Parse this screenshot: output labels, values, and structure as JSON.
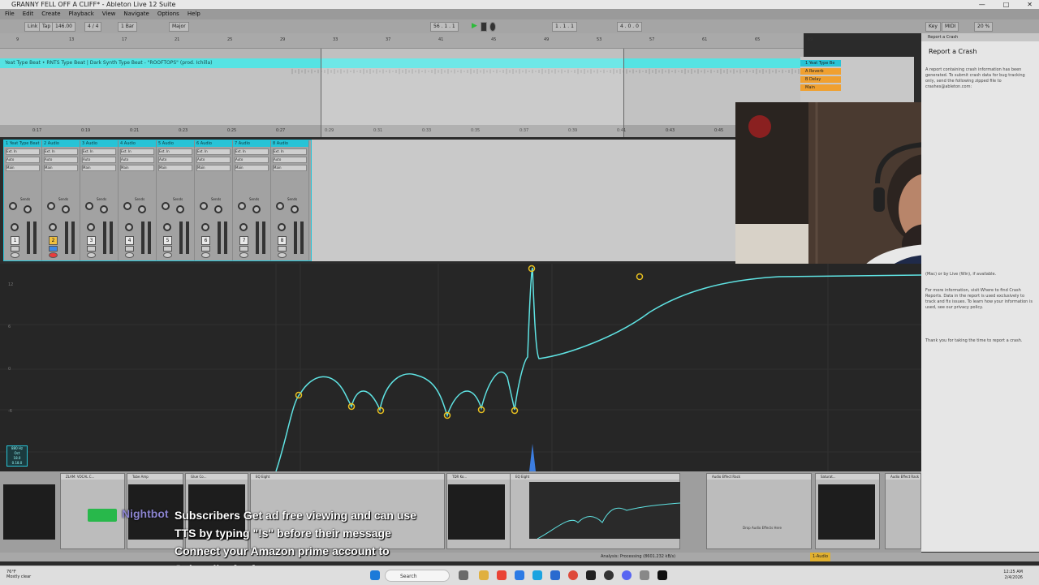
{
  "window": {
    "title": "GRANNY FELL OFF A CLIFF* - Ableton Live 12 Suite",
    "controls": [
      "—",
      "□",
      "✕"
    ]
  },
  "menu": [
    "File",
    "Edit",
    "Create",
    "Playback",
    "View",
    "Navigate",
    "Options",
    "Help"
  ],
  "controlbar": {
    "link": "Link",
    "tap": "Tap",
    "tempo": "146.00",
    "signature": "4 / 4",
    "bar": "1 Bar",
    "key": "Major",
    "position": "56 . 1 . 1",
    "loop_start": "1 . 1 . 1",
    "loop_len": "4 . 0 . 0",
    "zoom": "20 %",
    "key_btn": "Key",
    "midi": "MIDI",
    "cpu": "20 %"
  },
  "arrangement": {
    "clip_label": "Yeat Type Beat • RNTS Type Beat | Dark Synth Type Beat - \"ROOFTOPS\" (prod. Ichilla)",
    "ruler": [
      "9",
      "13",
      "17",
      "21",
      "25",
      "29",
      "33",
      "37",
      "41",
      "45",
      "49",
      "53",
      "57",
      "61",
      "65",
      "69"
    ],
    "timeline": [
      "0:17",
      "0:19",
      "0:21",
      "0:23",
      "0:25",
      "0:27",
      "0:29",
      "0:31",
      "0:33",
      "0:35",
      "0:37",
      "0:39",
      "0:41",
      "0:43",
      "0:45"
    ]
  },
  "track_heads": [
    {
      "name": "1 Yeat Type Be",
      "color": "#27c3d6"
    },
    {
      "name": "A Reverb",
      "color": "#f0a030"
    },
    {
      "name": "B Delay",
      "color": "#f0a030"
    },
    {
      "name": "Main",
      "color": "#f0a030"
    }
  ],
  "mixer": {
    "strips": [
      {
        "name": "1 Yeat Type Beat",
        "num": "1",
        "audio_from": "Ext. In",
        "monitor": "Auto",
        "audio_to": "Main"
      },
      {
        "name": "2 Audio",
        "num": "2",
        "audio_from": "Ext. In",
        "monitor": "Auto",
        "audio_to": "Main"
      },
      {
        "name": "3 Audio",
        "num": "3",
        "audio_from": "Ext. In",
        "monitor": "Auto",
        "audio_to": "Main"
      },
      {
        "name": "4 Audio",
        "num": "4",
        "audio_from": "Ext. In",
        "monitor": "Auto",
        "audio_to": "Main"
      },
      {
        "name": "5 Audio",
        "num": "5",
        "audio_from": "Ext. In",
        "monitor": "Auto",
        "audio_to": "Main"
      },
      {
        "name": "6 Audio",
        "num": "6",
        "audio_from": "Ext. In",
        "monitor": "Auto",
        "audio_to": "Main"
      },
      {
        "name": "7 Audio",
        "num": "7",
        "audio_from": "Ext. In",
        "monitor": "Auto",
        "audio_to": "Main"
      },
      {
        "name": "8 Audio",
        "num": "8",
        "audio_from": "Ext. In",
        "monitor": "Auto",
        "audio_to": "Main"
      }
    ],
    "sends_label": "Sends"
  },
  "eq": {
    "curve_color": "#5fe3e3",
    "node_color": "#e8c020",
    "y_labels": [
      "12",
      "6",
      "0",
      "-6"
    ],
    "loop_box": [
      "880 Hz",
      "Oct",
      "18.0",
      "0.18.0"
    ]
  },
  "crash": {
    "panel_title": "Report a Crash",
    "title": "Report a Crash",
    "text1": "A report containing crash information has been generated. To submit crash data for bug tracking only, send the following zipped file to crashes@ableton.com:",
    "text2": "(Mac) or by Live (Win), if available.",
    "text3": "For more information, visit Where to find Crash Reports. Data in the report is used exclusively to track and fix issues. To learn how your information is used, see our privacy policy.",
    "text4": "Thank you for taking the time to report a crash."
  },
  "devices": [
    {
      "name": "ZLAM: VOCAL C..."
    },
    {
      "name": "Tube Amp"
    },
    {
      "name": "Glue Co..."
    },
    {
      "name": "EQ Eight"
    },
    {
      "name": "TDR Ko..."
    },
    {
      "name": "EQ Eight"
    },
    {
      "name": "Audio Effect Rack"
    },
    {
      "name": "Saturat..."
    },
    {
      "name": "Audio Effect Rack"
    }
  ],
  "device_drop": "Drop Audio Effects Here",
  "status": {
    "analysis": "Analysis: Processing (8601.232 kB/s)",
    "right": "1-Audio"
  },
  "chat": {
    "bot": "Nightbot",
    "line1": "Subscribers Get ad free viewing and can use",
    "line2": "TTS by typing \"!s\" before their message",
    "line3": "Connect your Amazon prime account to",
    "line4": "Subscribe for free"
  },
  "taskbar": {
    "weather_temp": "76°F",
    "weather_desc": "Mostly clear",
    "search": "Search",
    "time": "12:25 AM",
    "date": "2/4/2026"
  }
}
